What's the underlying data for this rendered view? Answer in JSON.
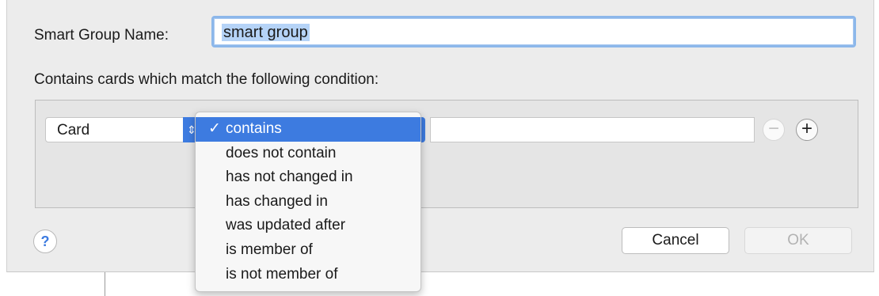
{
  "dialog": {
    "name_label": "Smart Group Name:",
    "name_value": "smart group",
    "condition_label": "Contains cards which match the following condition:",
    "help_label": "?",
    "cancel_label": "Cancel",
    "ok_label": "OK"
  },
  "rule": {
    "field_selected": "Card",
    "popup_arrows": "⇕",
    "value": "",
    "remove_label": "−",
    "add_label": "+"
  },
  "operator_menu": {
    "check_mark": "✓",
    "selected_index": 0,
    "items": [
      {
        "label": "contains"
      },
      {
        "label": "does not contain"
      },
      {
        "label": "has not changed in"
      },
      {
        "label": "has changed in"
      },
      {
        "label": "was updated after"
      },
      {
        "label": "is member of"
      },
      {
        "label": "is not member of"
      }
    ]
  },
  "colors": {
    "accent": "#3d7be0",
    "focus_ring": "#8cb7ea",
    "dialog_bg": "#ececec"
  }
}
